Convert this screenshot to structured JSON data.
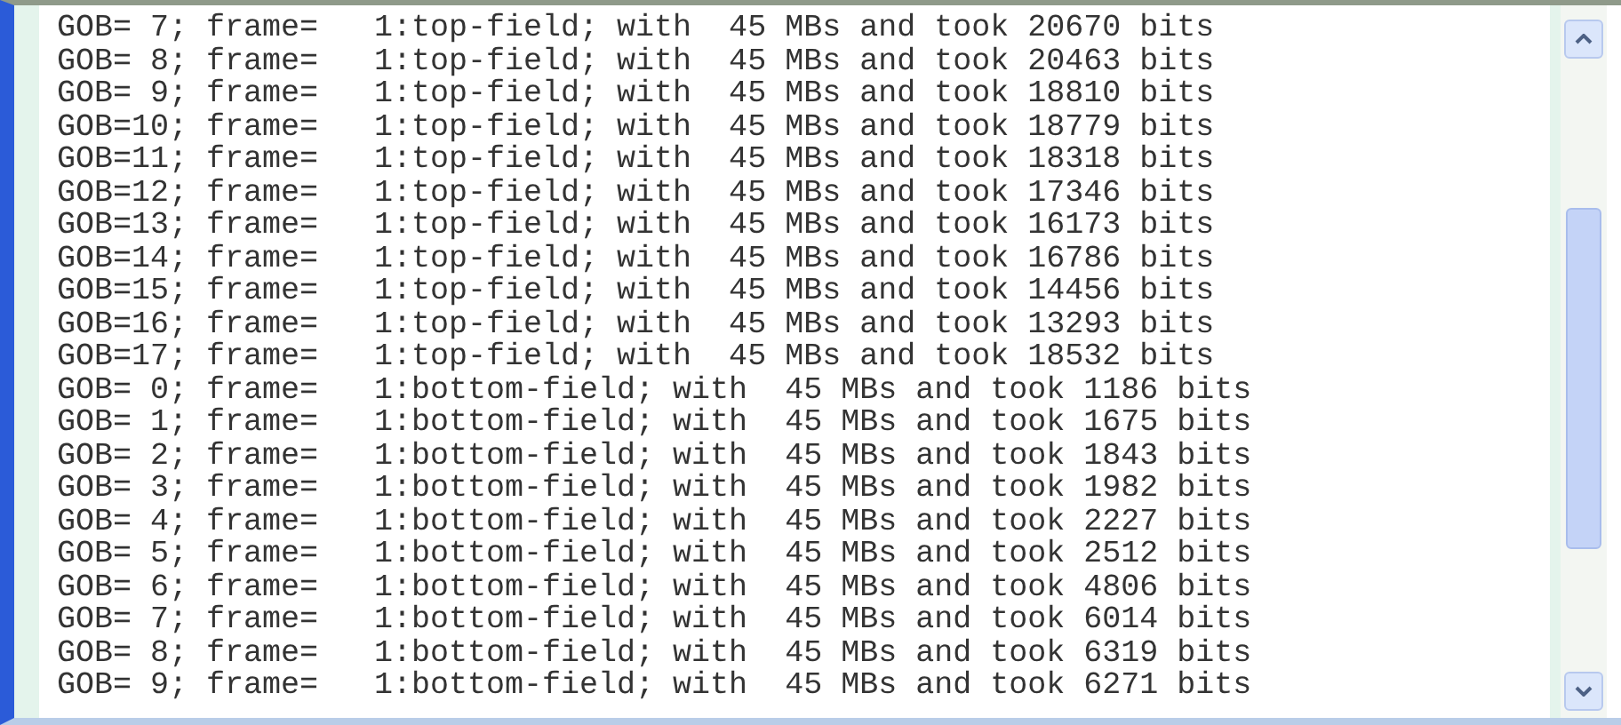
{
  "log_lines": [
    "GOB= 7; frame=   1:top-field; with  45 MBs and took 20670 bits",
    "GOB= 8; frame=   1:top-field; with  45 MBs and took 20463 bits",
    "GOB= 9; frame=   1:top-field; with  45 MBs and took 18810 bits",
    "GOB=10; frame=   1:top-field; with  45 MBs and took 18779 bits",
    "GOB=11; frame=   1:top-field; with  45 MBs and took 18318 bits",
    "GOB=12; frame=   1:top-field; with  45 MBs and took 17346 bits",
    "GOB=13; frame=   1:top-field; with  45 MBs and took 16173 bits",
    "GOB=14; frame=   1:top-field; with  45 MBs and took 16786 bits",
    "GOB=15; frame=   1:top-field; with  45 MBs and took 14456 bits",
    "GOB=16; frame=   1:top-field; with  45 MBs and took 13293 bits",
    "GOB=17; frame=   1:top-field; with  45 MBs and took 18532 bits",
    "GOB= 0; frame=   1:bottom-field; with  45 MBs and took 1186 bits",
    "GOB= 1; frame=   1:bottom-field; with  45 MBs and took 1675 bits",
    "GOB= 2; frame=   1:bottom-field; with  45 MBs and took 1843 bits",
    "GOB= 3; frame=   1:bottom-field; with  45 MBs and took 1982 bits",
    "GOB= 4; frame=   1:bottom-field; with  45 MBs and took 2227 bits",
    "GOB= 5; frame=   1:bottom-field; with  45 MBs and took 2512 bits",
    "GOB= 6; frame=   1:bottom-field; with  45 MBs and took 4806 bits",
    "GOB= 7; frame=   1:bottom-field; with  45 MBs and took 6014 bits",
    "GOB= 8; frame=   1:bottom-field; with  45 MBs and took 6319 bits",
    "GOB= 9; frame=   1:bottom-field; with  45 MBs and took 6271 bits"
  ]
}
